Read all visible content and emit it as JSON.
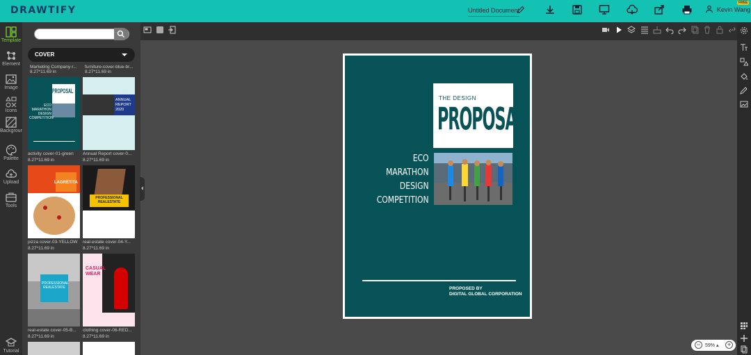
{
  "app": {
    "logo": "DRAWTIFY"
  },
  "header": {
    "document_title": "Untitled Document",
    "user_name": "Kevin Wang",
    "badge": "FREE"
  },
  "left_rail": {
    "items": [
      {
        "label": "Template",
        "icon": "template-icon"
      },
      {
        "label": "Element",
        "icon": "element-icon"
      },
      {
        "label": "Image",
        "icon": "image-icon"
      },
      {
        "label": "Icons",
        "icon": "icons-icon"
      },
      {
        "label": "Background",
        "icon": "background-icon"
      },
      {
        "label": "Palette",
        "icon": "palette-icon"
      },
      {
        "label": "Upload",
        "icon": "upload-icon"
      },
      {
        "label": "Tools",
        "icon": "tools-icon"
      },
      {
        "label": "Tutorial",
        "icon": "tutorial-icon"
      }
    ]
  },
  "panel": {
    "search_placeholder": "",
    "category": "COVER",
    "top_labels": [
      {
        "name": "Marketing Company-r...",
        "size": "8.27*11.69 in"
      },
      {
        "name": "furniture-cover-blue-br...",
        "size": ""
      }
    ],
    "templates": [
      {
        "name": "activity cover-01-green",
        "size": "8.27*11.69 in"
      },
      {
        "name": "Annual Report cover-0...",
        "size": "8.27*11.69 in"
      },
      {
        "name": "pizza cover-03-YELLOW",
        "size": "8.27*11.69 in"
      },
      {
        "name": "real-estate cover-04-Y...",
        "size": "8.27*11.69 in"
      },
      {
        "name": "real-estate cover-05-B...",
        "size": "8.27*11.69 in"
      },
      {
        "name": "clothing cover-06-RED...",
        "size": "8.27*11.69 in"
      }
    ],
    "thumb_text": {
      "proposal": "PROPOSAL",
      "eco": "ECO MARATHON DESIGN COMPETITION",
      "annual": "ANNUAL REPORT 2020",
      "lagretita": "LAGRETITA",
      "pro_real": "PROFESSIONAL REALESTATE",
      "pro_real2": "PROFESSIONAL REALESTATE",
      "casual": "CASUAL WEAR"
    }
  },
  "canvas": {
    "the_design": "THE DESIGN",
    "proposal": "PROPOSAL",
    "eco_lines": [
      "ECO",
      "MARATHON",
      "DESIGN",
      "COMPETITION"
    ],
    "proposed_by": "PROPOSED BY",
    "company": "DIGITAL GLOBAL CORPORATION"
  },
  "zoom": {
    "value": "59%",
    "minus": "−",
    "plus": "+"
  },
  "colors": {
    "brand": "#13c2b3",
    "doc_bg": "#065256",
    "active": "#7fd13b"
  }
}
